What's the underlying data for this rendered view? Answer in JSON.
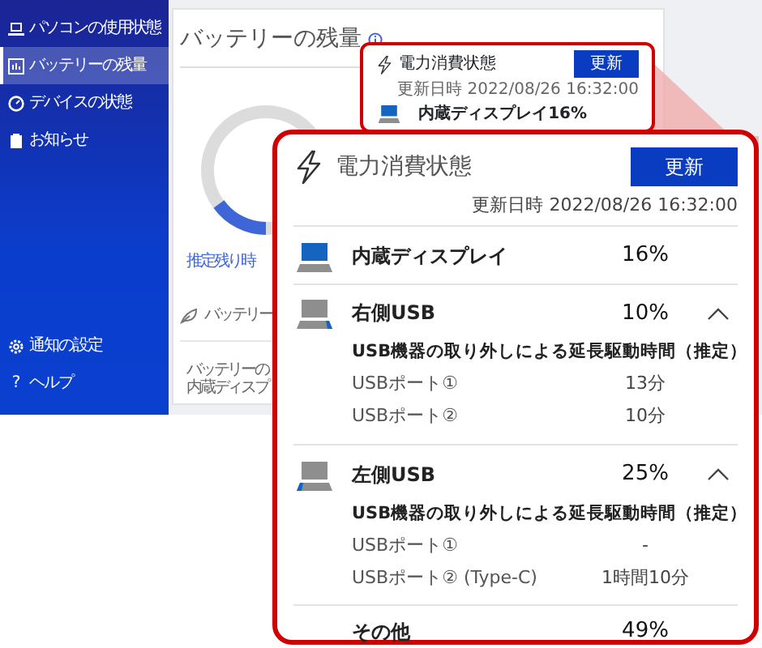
{
  "sidebar": {
    "items": [
      {
        "label": "パソコンの使用状態",
        "kind": "laptop",
        "selected": false
      },
      {
        "label": "バッテリーの残量",
        "kind": "battery",
        "selected": true
      },
      {
        "label": "デバイスの状態",
        "kind": "gauge",
        "selected": false
      },
      {
        "label": "お知らせ",
        "kind": "clipboard",
        "selected": false
      }
    ],
    "footer_items": [
      {
        "label": "通知の設定",
        "kind": "gear"
      },
      {
        "label": "ヘルプ",
        "glyph": "?"
      }
    ]
  },
  "main_panel": {
    "title": "バッテリーの残量",
    "gauge_caption": "推定残り時",
    "battery_label": "バッテリー",
    "note_lines": [
      "バッテリーの",
      "内蔵ディスプ"
    ]
  },
  "mini_card": {
    "title": "電力消費状態",
    "button": "更新",
    "updated": "更新日時 2022/08/26 16:32:00",
    "row": {
      "kind": "display",
      "name": "内蔵ディスプレイ",
      "percent": "16%"
    }
  },
  "callout": {
    "title": "電力消費状態",
    "button": "更新",
    "updated": "更新日時 2022/08/26 16:32:00",
    "rows": [
      {
        "kind": "display",
        "name": "内蔵ディスプレイ",
        "percent": "16%"
      },
      {
        "kind": "usb_right",
        "name": "右側USB",
        "percent": "10%",
        "expanded": true,
        "detail_heading": "USB機器の取り外しによる延長駆動時間（推定）",
        "ports": [
          {
            "label": "USBポート①",
            "time": "13分"
          },
          {
            "label": "USBポート②",
            "time": "10分"
          }
        ]
      },
      {
        "kind": "usb_left",
        "name": "左側USB",
        "percent": "25%",
        "expanded": true,
        "detail_heading": "USB機器の取り外しによる延長駆動時間（推定）",
        "ports": [
          {
            "label": "USBポート①",
            "time": "-"
          },
          {
            "label": "USBポート② (Type-C)",
            "time": "1時間10分"
          }
        ]
      },
      {
        "kind": "other",
        "name": "その他",
        "percent": "49%"
      }
    ]
  }
}
